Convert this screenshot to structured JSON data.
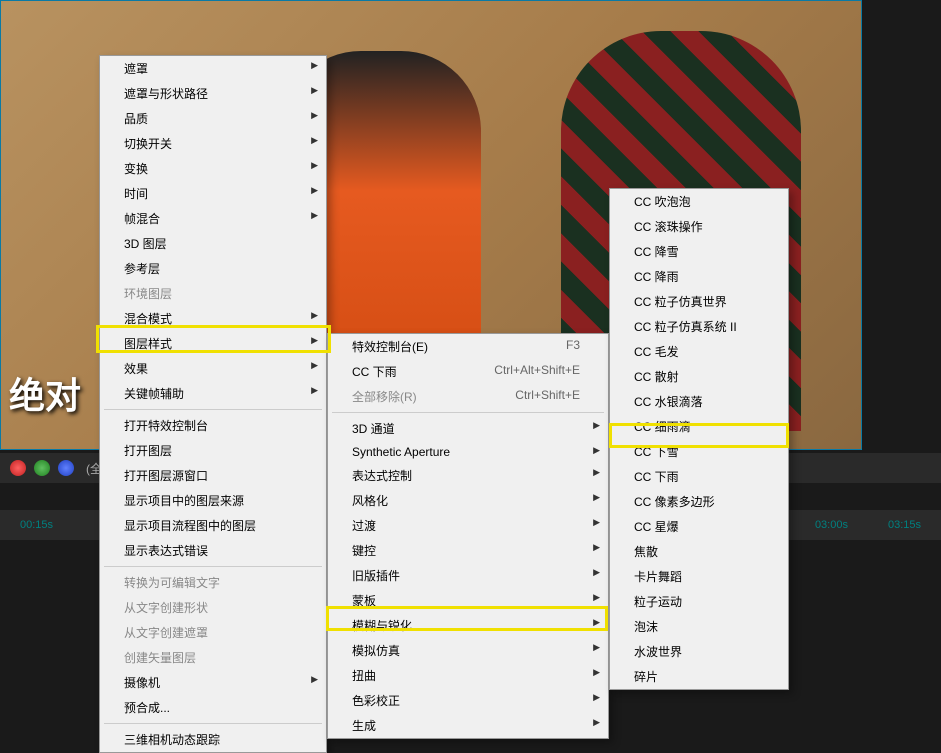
{
  "viewer": {
    "subtitle_text": "绝对"
  },
  "toolbar": {
    "resolution_label": "(全分辨"
  },
  "timeline": {
    "t1": "00:15s",
    "t2": "03:00s",
    "t3": "03:15s"
  },
  "menu1": {
    "items": [
      {
        "label": "遮罩",
        "sub": true
      },
      {
        "label": "遮罩与形状路径",
        "sub": true
      },
      {
        "label": "品质",
        "sub": true
      },
      {
        "label": "切换开关",
        "sub": true
      },
      {
        "label": "变换",
        "sub": true
      },
      {
        "label": "时间",
        "sub": true
      },
      {
        "label": "帧混合",
        "sub": true
      },
      {
        "label": "3D 图层"
      },
      {
        "label": "参考层"
      },
      {
        "label": "环境图层",
        "disabled": true
      },
      {
        "label": "混合模式",
        "sub": true
      },
      {
        "label": "图层样式",
        "sub": true
      },
      {
        "label": "效果",
        "sub": true
      },
      {
        "label": "关键帧辅助",
        "sub": true
      },
      {
        "sep": true
      },
      {
        "label": "打开特效控制台"
      },
      {
        "label": "打开图层"
      },
      {
        "label": "打开图层源窗口"
      },
      {
        "label": "显示项目中的图层来源"
      },
      {
        "label": "显示项目流程图中的图层"
      },
      {
        "label": "显示表达式错误"
      },
      {
        "sep": true
      },
      {
        "label": "转换为可编辑文字",
        "disabled": true
      },
      {
        "label": "从文字创建形状",
        "disabled": true
      },
      {
        "label": "从文字创建遮罩",
        "disabled": true
      },
      {
        "label": "创建矢量图层",
        "disabled": true
      },
      {
        "label": "摄像机",
        "sub": true
      },
      {
        "label": "预合成..."
      },
      {
        "sep": true
      },
      {
        "label": "三维相机动态跟踪"
      }
    ]
  },
  "menu2": {
    "items": [
      {
        "label": "特效控制台(E)",
        "shortcut": "F3"
      },
      {
        "label": "CC 下雨",
        "shortcut": "Ctrl+Alt+Shift+E"
      },
      {
        "label": "全部移除(R)",
        "shortcut": "Ctrl+Shift+E",
        "disabled": true
      },
      {
        "sep": true
      },
      {
        "label": "3D 通道",
        "sub": true
      },
      {
        "label": "Synthetic Aperture",
        "sub": true
      },
      {
        "label": "表达式控制",
        "sub": true
      },
      {
        "label": "风格化",
        "sub": true
      },
      {
        "label": "过渡",
        "sub": true
      },
      {
        "label": "键控",
        "sub": true
      },
      {
        "label": "旧版插件",
        "sub": true
      },
      {
        "label": "蒙板",
        "sub": true
      },
      {
        "label": "模糊与锐化",
        "sub": true
      },
      {
        "label": "模拟仿真",
        "sub": true
      },
      {
        "label": "扭曲",
        "sub": true
      },
      {
        "label": "色彩校正",
        "sub": true
      },
      {
        "label": "生成",
        "sub": true
      }
    ]
  },
  "menu3": {
    "items": [
      {
        "label": "CC 吹泡泡"
      },
      {
        "label": "CC 滚珠操作"
      },
      {
        "label": "CC 降雪"
      },
      {
        "label": "CC 降雨"
      },
      {
        "label": "CC 粒子仿真世界"
      },
      {
        "label": "CC 粒子仿真系统 II"
      },
      {
        "label": "CC 毛发"
      },
      {
        "label": "CC 散射"
      },
      {
        "label": "CC 水银滴落"
      },
      {
        "label": "CC 细雨滴"
      },
      {
        "label": "CC 下雪"
      },
      {
        "label": "CC 下雨"
      },
      {
        "label": "CC 像素多边形"
      },
      {
        "label": "CC 星爆"
      },
      {
        "label": "焦散"
      },
      {
        "label": "卡片舞蹈"
      },
      {
        "label": "粒子运动"
      },
      {
        "label": "泡沫"
      },
      {
        "label": "水波世界"
      },
      {
        "label": "碎片"
      }
    ]
  }
}
